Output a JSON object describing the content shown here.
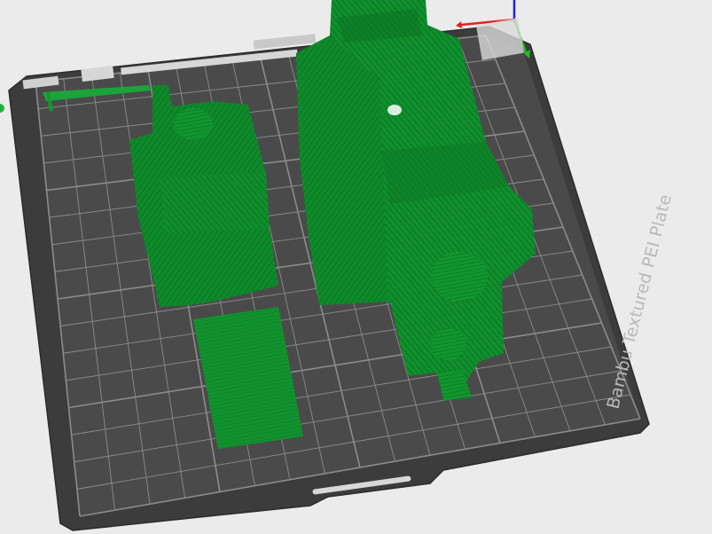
{
  "viewport": {
    "plate_label": "Bambu Textured PEI Plate"
  },
  "colors": {
    "background": "#ebebeb",
    "plate": "#4a4a4a",
    "plate_edge": "#3a3a3a",
    "grid": "#8a8a8a",
    "model": "#0e8a2a",
    "model_dark": "#0a6a20",
    "model_light": "#1aa43a",
    "axis_x": "#e02020",
    "axis_y": "#20c020",
    "axis_z": "#2020e0"
  },
  "icons": [
    "axis-gizmo-icon"
  ]
}
